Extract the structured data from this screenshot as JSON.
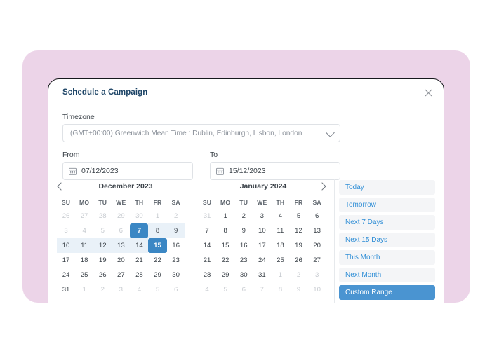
{
  "modal": {
    "title": "Schedule a Campaign",
    "close_icon": "close-icon"
  },
  "timezone": {
    "label": "Timezone",
    "value": "(GMT+00:00) Greenwich Mean Time : Dublin, Edinburgh, Lisbon, London",
    "chevron_icon": "chevron-down-icon"
  },
  "range": {
    "from": {
      "label": "From",
      "value": "07/12/2023",
      "icon": "calendar-icon"
    },
    "to": {
      "label": "To",
      "value": "15/12/2023",
      "icon": "calendar-icon"
    }
  },
  "nav": {
    "prev_icon": "chevron-left-icon",
    "next_icon": "chevron-right-icon"
  },
  "weekdays": [
    "SU",
    "MO",
    "TU",
    "WE",
    "TH",
    "FR",
    "SA"
  ],
  "calendars": [
    {
      "title": "December 2023",
      "weeks": [
        [
          {
            "d": "26",
            "state": "muted"
          },
          {
            "d": "27",
            "state": "muted"
          },
          {
            "d": "28",
            "state": "muted"
          },
          {
            "d": "29",
            "state": "muted"
          },
          {
            "d": "30",
            "state": "muted"
          },
          {
            "d": "1",
            "state": "muted"
          },
          {
            "d": "2",
            "state": "muted"
          }
        ],
        [
          {
            "d": "3",
            "state": "muted"
          },
          {
            "d": "4",
            "state": "muted"
          },
          {
            "d": "5",
            "state": "muted"
          },
          {
            "d": "6",
            "state": "muted"
          },
          {
            "d": "7",
            "state": "selected"
          },
          {
            "d": "8",
            "state": "inrange"
          },
          {
            "d": "9",
            "state": "inrange"
          }
        ],
        [
          {
            "d": "10",
            "state": "inrange"
          },
          {
            "d": "11",
            "state": "inrange"
          },
          {
            "d": "12",
            "state": "inrange"
          },
          {
            "d": "13",
            "state": "inrange"
          },
          {
            "d": "14",
            "state": "inrange"
          },
          {
            "d": "15",
            "state": "selected"
          },
          {
            "d": "16",
            "state": "normal"
          }
        ],
        [
          {
            "d": "17",
            "state": "normal"
          },
          {
            "d": "18",
            "state": "normal"
          },
          {
            "d": "19",
            "state": "normal"
          },
          {
            "d": "20",
            "state": "normal"
          },
          {
            "d": "21",
            "state": "normal"
          },
          {
            "d": "22",
            "state": "normal"
          },
          {
            "d": "23",
            "state": "normal"
          }
        ],
        [
          {
            "d": "24",
            "state": "normal"
          },
          {
            "d": "25",
            "state": "normal"
          },
          {
            "d": "26",
            "state": "normal"
          },
          {
            "d": "27",
            "state": "normal"
          },
          {
            "d": "28",
            "state": "normal"
          },
          {
            "d": "29",
            "state": "normal"
          },
          {
            "d": "30",
            "state": "normal"
          }
        ],
        [
          {
            "d": "31",
            "state": "normal"
          },
          {
            "d": "1",
            "state": "muted"
          },
          {
            "d": "2",
            "state": "muted"
          },
          {
            "d": "3",
            "state": "muted"
          },
          {
            "d": "4",
            "state": "muted"
          },
          {
            "d": "5",
            "state": "muted"
          },
          {
            "d": "6",
            "state": "muted"
          }
        ]
      ]
    },
    {
      "title": "January 2024",
      "weeks": [
        [
          {
            "d": "31",
            "state": "muted"
          },
          {
            "d": "1",
            "state": "normal"
          },
          {
            "d": "2",
            "state": "normal"
          },
          {
            "d": "3",
            "state": "normal"
          },
          {
            "d": "4",
            "state": "normal"
          },
          {
            "d": "5",
            "state": "normal"
          },
          {
            "d": "6",
            "state": "normal"
          }
        ],
        [
          {
            "d": "7",
            "state": "normal"
          },
          {
            "d": "8",
            "state": "normal"
          },
          {
            "d": "9",
            "state": "normal"
          },
          {
            "d": "10",
            "state": "normal"
          },
          {
            "d": "11",
            "state": "normal"
          },
          {
            "d": "12",
            "state": "normal"
          },
          {
            "d": "13",
            "state": "normal"
          }
        ],
        [
          {
            "d": "14",
            "state": "normal"
          },
          {
            "d": "15",
            "state": "normal"
          },
          {
            "d": "16",
            "state": "normal"
          },
          {
            "d": "17",
            "state": "normal"
          },
          {
            "d": "18",
            "state": "normal"
          },
          {
            "d": "19",
            "state": "normal"
          },
          {
            "d": "20",
            "state": "normal"
          }
        ],
        [
          {
            "d": "21",
            "state": "normal"
          },
          {
            "d": "22",
            "state": "normal"
          },
          {
            "d": "23",
            "state": "normal"
          },
          {
            "d": "24",
            "state": "normal"
          },
          {
            "d": "25",
            "state": "normal"
          },
          {
            "d": "26",
            "state": "normal"
          },
          {
            "d": "27",
            "state": "normal"
          }
        ],
        [
          {
            "d": "28",
            "state": "normal"
          },
          {
            "d": "29",
            "state": "normal"
          },
          {
            "d": "30",
            "state": "normal"
          },
          {
            "d": "31",
            "state": "normal"
          },
          {
            "d": "1",
            "state": "muted"
          },
          {
            "d": "2",
            "state": "muted"
          },
          {
            "d": "3",
            "state": "muted"
          }
        ],
        [
          {
            "d": "4",
            "state": "muted"
          },
          {
            "d": "5",
            "state": "muted"
          },
          {
            "d": "6",
            "state": "muted"
          },
          {
            "d": "7",
            "state": "muted"
          },
          {
            "d": "8",
            "state": "muted"
          },
          {
            "d": "9",
            "state": "muted"
          },
          {
            "d": "10",
            "state": "muted"
          }
        ]
      ]
    }
  ],
  "presets": [
    {
      "label": "Today",
      "active": false
    },
    {
      "label": "Tomorrow",
      "active": false
    },
    {
      "label": "Next 7 Days",
      "active": false
    },
    {
      "label": "Next 15 Days",
      "active": false
    },
    {
      "label": "This Month",
      "active": false
    },
    {
      "label": "Next Month",
      "active": false
    },
    {
      "label": "Custom Range",
      "active": true
    }
  ],
  "colors": {
    "backdrop_pink": "#ecd4e8",
    "title_navy": "#1d4466",
    "accent_blue": "#3b87c4",
    "preset_blue": "#4a94d1",
    "preset_text_blue": "#2f8ed6",
    "range_highlight": "#e9f1f8",
    "preset_bg": "#f4f5f7"
  }
}
